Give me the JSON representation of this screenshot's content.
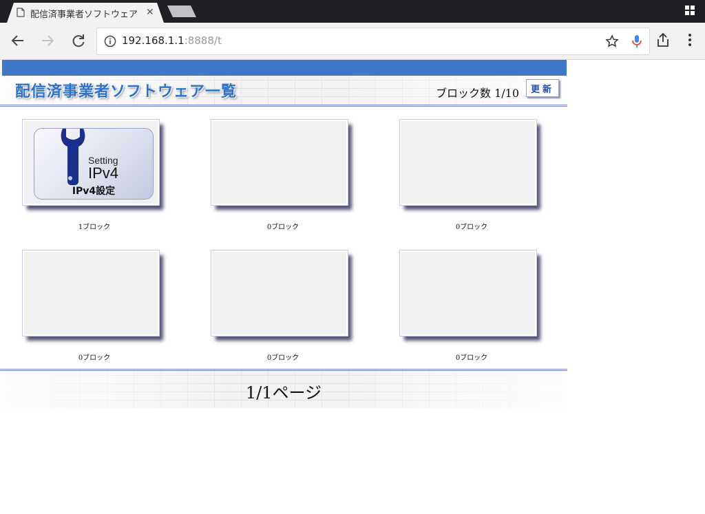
{
  "browser": {
    "tab_title": "配信済事業者ソフトウェア",
    "url_host": "192.168.1.1",
    "url_path": ":8888/t"
  },
  "header": {
    "title": "配信済事業者ソフトウェア一覧",
    "block_count": "ブロック数 1/10",
    "refresh_label": "更新"
  },
  "tiles": [
    {
      "label": "1ブロック",
      "setting_text": "Setting",
      "ipv4_text": "IPv4",
      "caption": "IPv4設定"
    },
    {
      "label": "0ブロック"
    },
    {
      "label": "0ブロック"
    },
    {
      "label": "0ブロック"
    },
    {
      "label": "0ブロック"
    },
    {
      "label": "0ブロック"
    }
  ],
  "footer": {
    "pagination": "1/1ページ"
  },
  "colors": {
    "header_bar": "#3f78c9",
    "title_text": "#2f73c8",
    "divider": "#7b86d6"
  }
}
